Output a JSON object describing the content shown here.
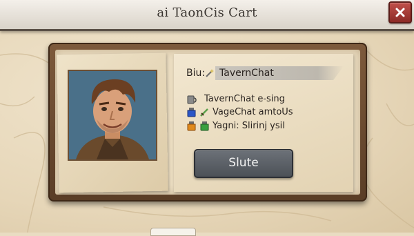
{
  "window": {
    "title": "ai TaonCis Cart"
  },
  "character": {
    "name_label": "Biu:",
    "name_value": "TavernChat",
    "portrait_icon": "hero-portrait"
  },
  "items": [
    {
      "icon": "mug-icon",
      "text": "TavernChat e-sing"
    },
    {
      "icon": "blue-potion-icon",
      "text": "VageChat amtoUs"
    },
    {
      "icon": "orange-potion-icon",
      "text": "Yagni: Slirinj ysil"
    }
  ],
  "actions": {
    "primary_label": "Slute"
  },
  "colors": {
    "frame": "#6b4a2f",
    "parchment": "#eadcc0",
    "close_button": "#a8382f",
    "primary_button": "#5b6067"
  }
}
